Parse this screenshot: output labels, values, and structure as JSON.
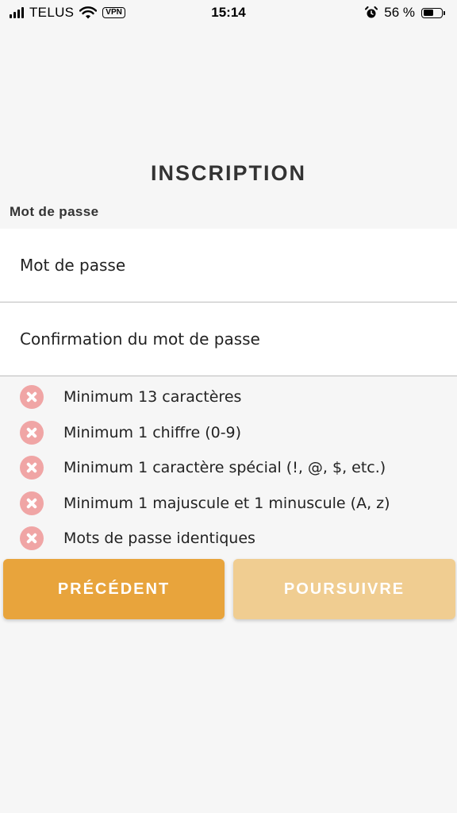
{
  "status_bar": {
    "carrier": "TELUS",
    "vpn": "VPN",
    "time": "15:14",
    "battery_percent": "56 %",
    "battery_level": 0.56
  },
  "page": {
    "title": "INSCRIPTION",
    "section_label": "Mot de passe"
  },
  "fields": {
    "password_placeholder": "Mot de passe",
    "password_value": "",
    "confirm_placeholder": "Confirmation du mot de passe",
    "confirm_value": ""
  },
  "rules": [
    {
      "label": "Minimum 13 caractères",
      "status": "failed",
      "icon": "close-icon"
    },
    {
      "label": "Minimum 1 chiffre (0-9)",
      "status": "failed",
      "icon": "close-icon"
    },
    {
      "label": "Minimum 1 caractère spécial (!, @, $, etc.)",
      "status": "failed",
      "icon": "close-icon"
    },
    {
      "label": "Minimum 1 majuscule et 1 minuscule (A, z)",
      "status": "failed",
      "icon": "close-icon"
    },
    {
      "label": "Mots de passe identiques",
      "status": "failed",
      "icon": "close-icon"
    }
  ],
  "buttons": {
    "previous_label": "PRÉCÉDENT",
    "next_label": "POURSUIVRE",
    "next_enabled": false
  },
  "colors": {
    "accent": "#e8a43c",
    "accent_disabled": "#f0cd91",
    "error_icon": "#f0a5a5",
    "background": "#f6f6f6"
  }
}
